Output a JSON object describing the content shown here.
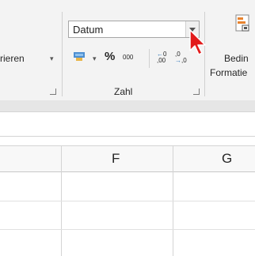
{
  "ribbon": {
    "left_group_fragment": "rieren",
    "number_format": {
      "value": "Datum"
    },
    "number_group": {
      "label": "Zahl",
      "percent": "%",
      "thousands": "000"
    },
    "cond_format": {
      "line1": "Bedin",
      "line2": "Formatie"
    }
  },
  "sheet": {
    "columns": [
      "F",
      "G"
    ]
  }
}
